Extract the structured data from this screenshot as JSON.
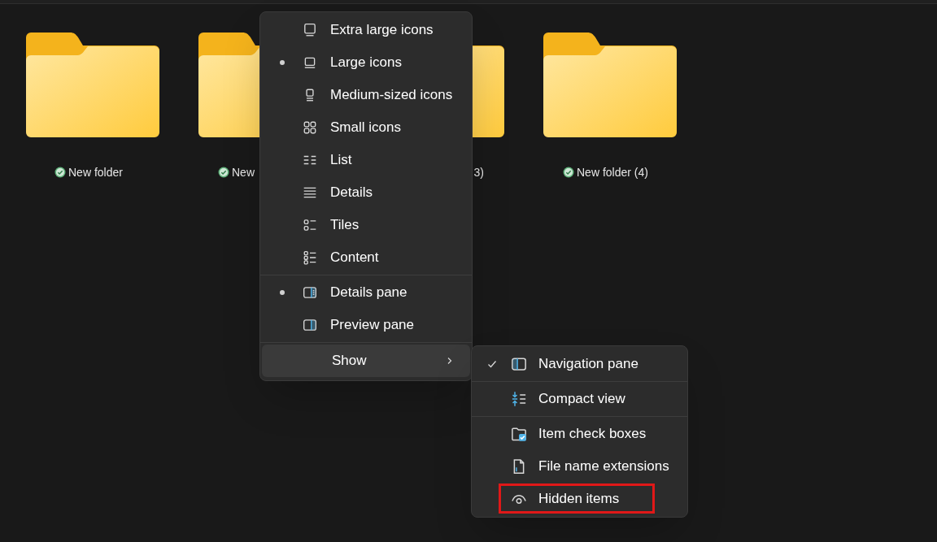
{
  "folders": [
    {
      "label": "New folder"
    },
    {
      "label": "New"
    },
    {
      "label": "3)"
    },
    {
      "label": "New folder (4)"
    }
  ],
  "view_menu": {
    "sections": [
      [
        {
          "label": "Extra large icons",
          "selected": false
        },
        {
          "label": "Large icons",
          "selected": true
        },
        {
          "label": "Medium-sized icons",
          "selected": false
        },
        {
          "label": "Small icons",
          "selected": false
        },
        {
          "label": "List",
          "selected": false
        },
        {
          "label": "Details",
          "selected": false
        },
        {
          "label": "Tiles",
          "selected": false
        },
        {
          "label": "Content",
          "selected": false
        }
      ],
      [
        {
          "label": "Details pane",
          "selected": true
        },
        {
          "label": "Preview pane",
          "selected": false
        }
      ],
      [
        {
          "label": "Show",
          "kind": "submenu",
          "highlighted": true
        }
      ]
    ]
  },
  "show_submenu": {
    "sections": [
      [
        {
          "label": "Navigation pane",
          "checked": true,
          "outlined": false
        }
      ],
      [
        {
          "label": "Compact view",
          "checked": false,
          "outlined": false
        }
      ],
      [
        {
          "label": "Item check boxes",
          "checked": false,
          "outlined": false
        },
        {
          "label": "File name extensions",
          "checked": false,
          "outlined": false
        },
        {
          "label": "Hidden items",
          "checked": false,
          "outlined": true
        }
      ]
    ]
  }
}
